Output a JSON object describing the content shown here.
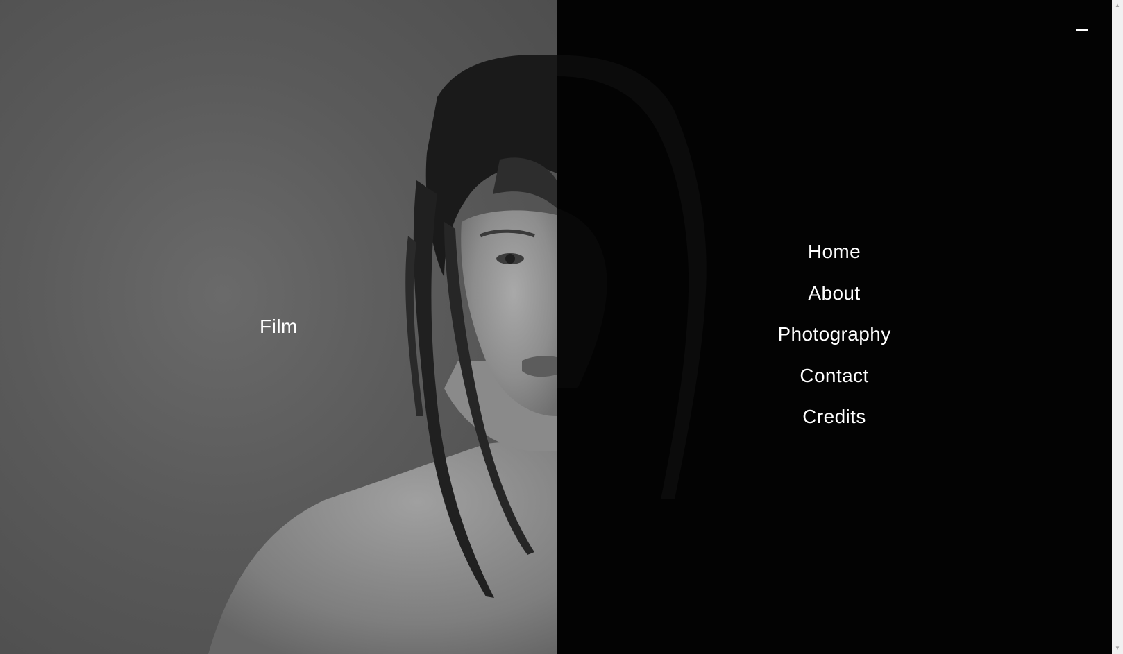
{
  "left_panel": {
    "label": "Film"
  },
  "menu": {
    "items": [
      {
        "label": "Home"
      },
      {
        "label": "About"
      },
      {
        "label": "Photography"
      },
      {
        "label": "Contact"
      },
      {
        "label": "Credits"
      }
    ]
  },
  "close_button": {
    "icon": "minus-icon"
  },
  "scrollbar": {
    "up_glyph": "▲",
    "down_glyph": "▼"
  },
  "colors": {
    "left_background": "#5a5a5a",
    "right_background": "#030303",
    "text": "#ffffff"
  }
}
